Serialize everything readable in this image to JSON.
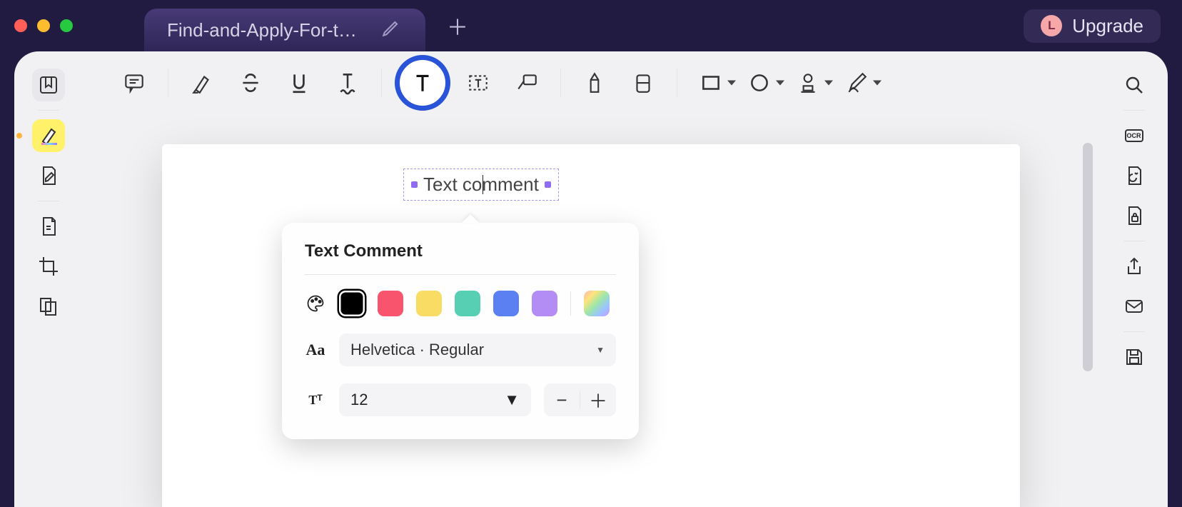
{
  "titlebar": {
    "tab_name": "Find-and-Apply-For-the-Be",
    "avatar_letter": "L",
    "upgrade_label": "Upgrade"
  },
  "toolbar": {
    "comment": "comment-icon",
    "highlight": "highlighter-icon",
    "strike": "strikethrough-icon",
    "underline": "underline-icon",
    "squiggly": "squiggly-underline-icon",
    "text": "text-icon",
    "textbox": "textbox-icon",
    "callout": "callout-icon",
    "pencil": "pencil-icon",
    "eraser": "eraser-icon",
    "rect": "shape-rect-icon",
    "ellipse": "shape-ellipse-icon",
    "stamp": "stamp-icon",
    "signature": "signature-icon"
  },
  "left_rail": {
    "bookmark": "bookmark-icon",
    "highlighter": "highlighter-icon",
    "edit": "edit-icon",
    "page_edit": "page-icon",
    "crop": "crop-icon",
    "compare": "compare-icon"
  },
  "right_rail": {
    "search": "search-icon",
    "ocr_label": "OCR",
    "convert": "convert-icon",
    "protect": "lock-file-icon",
    "share": "share-icon",
    "mail": "mail-icon",
    "save": "save-icon"
  },
  "page": {
    "text_comment_value": "Text comment"
  },
  "popup": {
    "title": "Text Comment",
    "colors": {
      "black": "#000000",
      "red": "#f8546e",
      "yellow": "#f8dc63",
      "teal": "#57cfb2",
      "blue": "#5a80f2",
      "purple": "#b38cf4"
    },
    "selected_color": "black",
    "font_label": "Helvetica · Regular",
    "size_value": "12"
  }
}
